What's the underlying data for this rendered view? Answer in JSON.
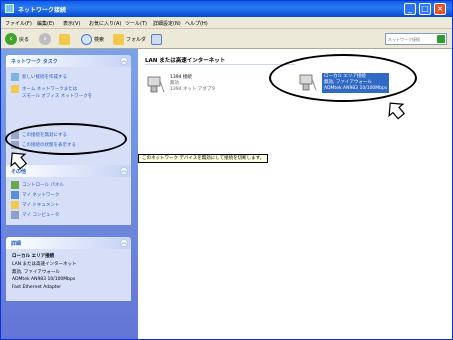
{
  "window": {
    "title": "ネットワーク接続",
    "minimize": "_",
    "maximize": "□",
    "close": "×"
  },
  "menu": [
    "ファイル(F)",
    "編集(E)",
    "表示(V)",
    "お気に入り(A)",
    "ツール(T)",
    "詳細設定(N)",
    "ヘルプ(H)"
  ],
  "toolbar": {
    "back_label": "戻る",
    "search_label": "検索",
    "folders_label": "フォルダ",
    "address_placeholder": "ネットワーク接続"
  },
  "sidebar": {
    "tasks_title": "ネットワーク タスク",
    "tasks": [
      "新しい接続を作成する",
      "ホーム ネットワークまたは",
      "スモール オフィス ネットワークを",
      "この接続を無効にする",
      "この接続の状態を表示する"
    ],
    "other_title": "その他",
    "other": [
      "コントロール パネル",
      "マイ ネットワーク",
      "マイ ドキュメント",
      "マイ コンピュータ"
    ],
    "details_title": "詳細",
    "details": [
      "ローカル エリア接続",
      "LAN または高速インターネット",
      "無効, ファイアウォール",
      "ADMtek AN983 10/100Mbps",
      "Fast Ethernet Adapter"
    ]
  },
  "main": {
    "group_title": "LAN または高速インターネット",
    "connections": [
      {
        "name": "1394 接続",
        "status": "無効",
        "device": "1394 ネット アダプタ"
      },
      {
        "name": "ローカル エリア接続",
        "status": "無効, ファイアウォール",
        "device": "ADMtek AN983 10/100Mbps"
      }
    ]
  },
  "tooltip": "このネットワーク デバイスを無効にして接続を切断します。"
}
